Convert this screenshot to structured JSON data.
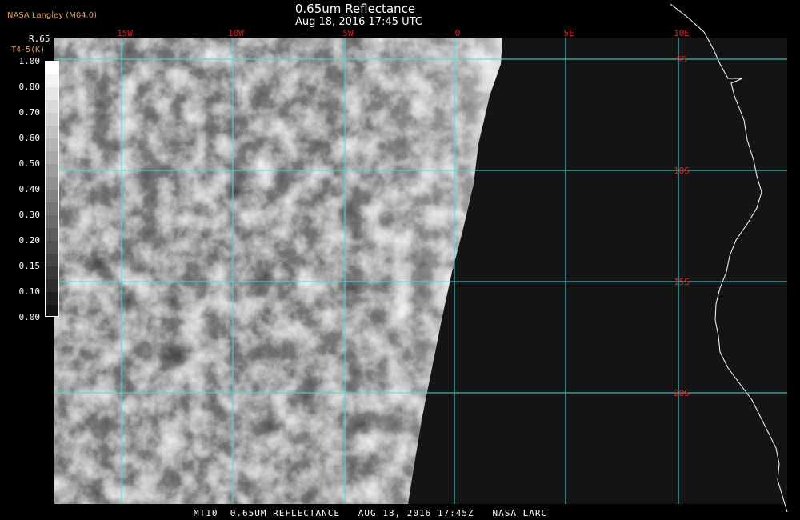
{
  "header": {
    "credit": "NASA Langley (M04.0)",
    "title": "0.65um Reflectance",
    "subtitle": "Aug 18, 2016 17:45 UTC"
  },
  "footer": {
    "caption": "MT10  0.65UM REFLECTANCE   AUG 18, 2016 17:45Z   NASA LARC"
  },
  "colorbar": {
    "label_top": "R.65",
    "label_bottom": "T4-5(K)",
    "ticks": [
      "1.00",
      "0.80",
      "0.70",
      "0.60",
      "0.50",
      "0.40",
      "0.30",
      "0.20",
      "0.15",
      "0.10",
      "0.00"
    ]
  },
  "map": {
    "longitude_labels": [
      "15W",
      "10W",
      "5W",
      "0",
      "5E",
      "10E"
    ],
    "latitude_labels": [
      "5S",
      "10S",
      "15S",
      "20S"
    ],
    "colors": {
      "grid": "#40e0e0",
      "grid_label": "#e02020",
      "coastline": "#ffffff",
      "background": "#000000",
      "dark_area": "#141414"
    }
  }
}
